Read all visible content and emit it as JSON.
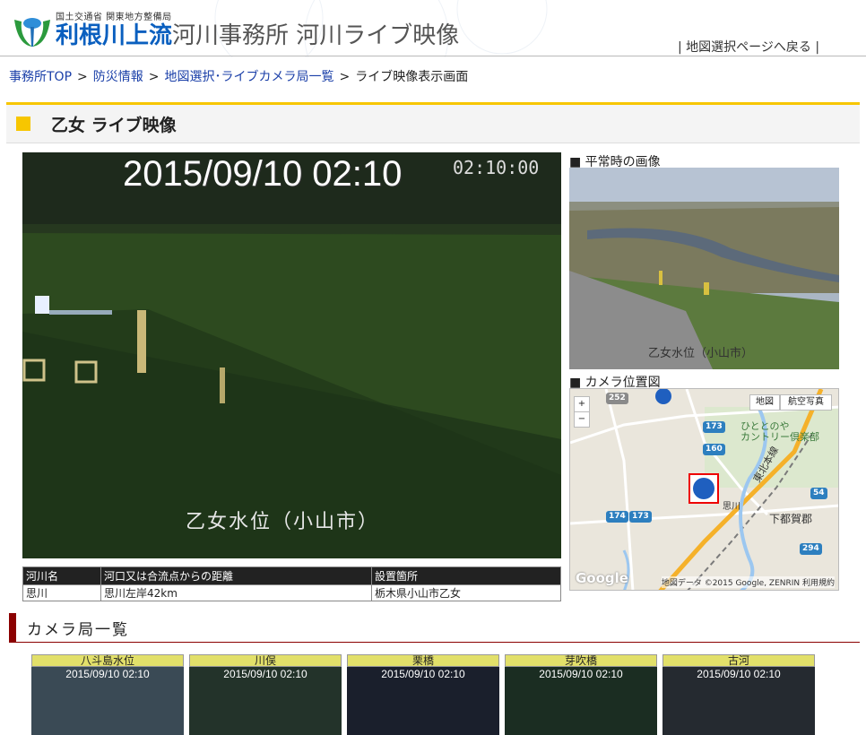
{
  "header": {
    "org": "国土交通省 関東地方整備局",
    "brand": "利根川上流",
    "subtitle": "河川事務所 河川ライブ映像",
    "back_link": "地図選択ページへ戻る"
  },
  "breadcrumb": [
    "事務所TOP",
    "防災情報",
    "地図選択･ライブカメラ局一覧",
    "ライブ映像表示画面"
  ],
  "page_title": "乙女 ライブ映像",
  "live": {
    "timestamp": "2015/09/10 02:10",
    "caption": "乙女水位（小山市）"
  },
  "info_table": {
    "headers": [
      "河川名",
      "河口又は合流点からの距離",
      "設置箇所"
    ],
    "row": [
      "思川",
      "思川左岸42km",
      "栃木県小山市乙女"
    ]
  },
  "side": {
    "normal_label": "■ 平常時の画像",
    "normal_caption": "乙女水位（小山市）",
    "map_label": "■ カメラ位置図",
    "map_btn_map": "地図",
    "map_btn_satellite": "航空写真",
    "map_labels": {
      "area": "下都賀郡",
      "club": "ひととのや\nカントリー倶楽部",
      "line": "東北本線",
      "station": "思川"
    },
    "map_route_numbers": [
      "252",
      "173",
      "160",
      "174",
      "173",
      "54",
      "294"
    ],
    "map_attribution": "地図データ ©2015 Google, ZENRIN 利用規約",
    "map_google": "Google",
    "zoom_in": "+",
    "zoom_out": "−"
  },
  "camera_list": {
    "heading": "カメラ局一覧",
    "items": [
      {
        "name": "八斗島水位",
        "timestamp": "2015/09/10 02:10"
      },
      {
        "name": "川俣",
        "timestamp": "2015/09/10 02:10"
      },
      {
        "name": "栗橋",
        "timestamp": "2015/09/10 02:10"
      },
      {
        "name": "芽吹橋",
        "timestamp": "2015/09/10 02:10"
      },
      {
        "name": "古河",
        "timestamp": "2015/09/10 02:10"
      }
    ]
  },
  "colors": {
    "brand_blue": "#0a5fbf",
    "accent_yellow": "#f7c600",
    "section_red": "#8b0000",
    "link_blue": "#1a3fa8"
  }
}
